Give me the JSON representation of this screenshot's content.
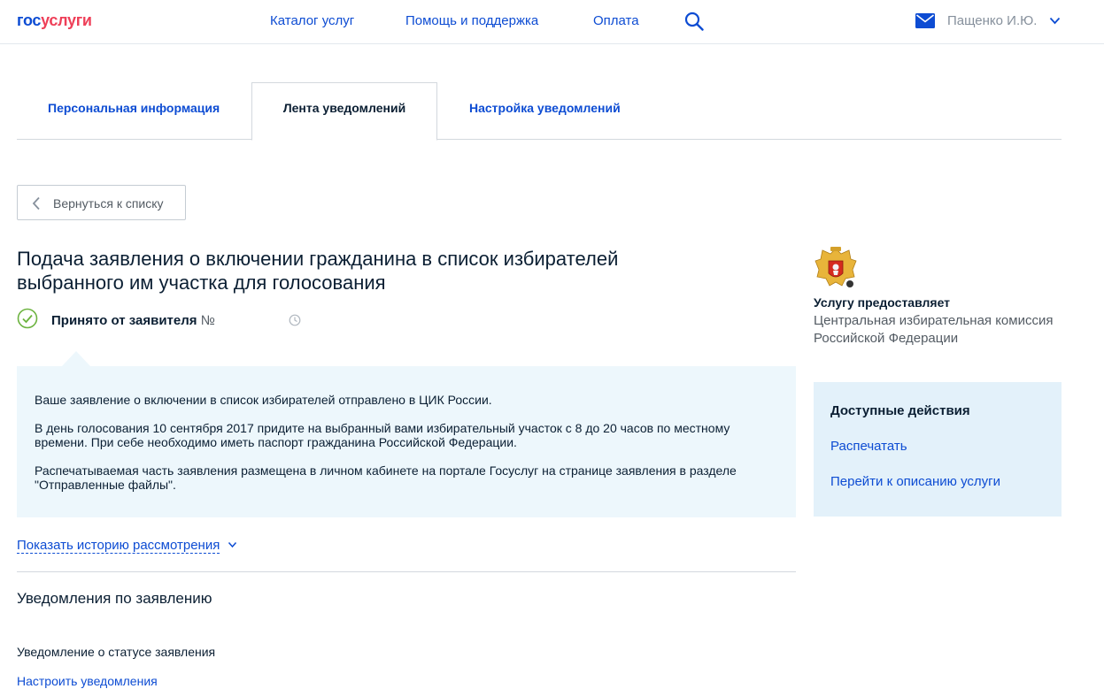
{
  "header": {
    "logo_part1": "гос",
    "logo_part2": "услуги",
    "nav": [
      "Каталог услуг",
      "Помощь и поддержка",
      "Оплата"
    ],
    "user_name": "Пащенко И.Ю."
  },
  "tabs": {
    "personal": "Персональная информация",
    "feed": "Лента уведомлений",
    "settings": "Настройка уведомлений"
  },
  "back_label": "Вернуться к списку",
  "title_line1": "Подача заявления о включении гражданина в список избирателей",
  "title_line2": "выбранного им участка для голосования",
  "status": {
    "label": "Принято от заявителя",
    "number_prefix": "№"
  },
  "info": {
    "p1": "Ваше заявление о включении в список избирателей отправлено в ЦИК России.",
    "p2_line1": "В день голосования 10 сентября 2017 придите на выбранный вами избирательный участок с 8 до 20 часов по местному",
    "p2_line2": "времени. При себе необходимо иметь паспорт гражданина Российской Федерации.",
    "p3_line1": "Распечатываемая часть заявления размещена в личном кабинете на портале Госуслуг на странице заявления в разделе",
    "p3_line2": "\"Отправленные файлы\"."
  },
  "history_link": "Показать историю рассмотрения",
  "notifications": {
    "title": "Уведомления по заявлению",
    "status_label": "Уведомление о статусе заявления",
    "setup_link": "Настроить уведомления"
  },
  "provider": {
    "label": "Услугу предоставляет",
    "name_line1": "Центральная избирательная комиссия",
    "name_line2": "Российской Федерации"
  },
  "actions": {
    "title": "Доступные действия",
    "print": "Распечатать",
    "describe": "Перейти к описанию услуги"
  },
  "colors": {
    "brand_blue": "#0d4cd3",
    "brand_red": "#ee3f58",
    "info_bg": "#edf7fc",
    "actions_bg": "#e3f1fa",
    "check_green": "#6cb33f"
  }
}
